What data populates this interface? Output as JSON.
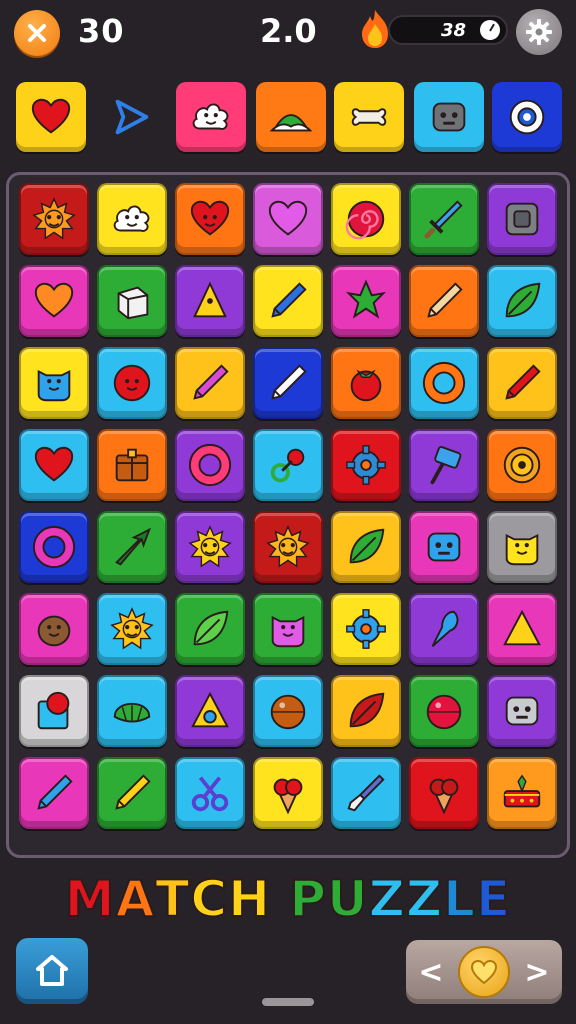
{
  "hud": {
    "moves": "30",
    "score": "2.0",
    "timer": "38",
    "close_icon": "close-icon",
    "flame_icon": "flame-icon",
    "clock_icon": "clock-icon",
    "settings_icon": "gear-icon"
  },
  "targets": [
    {
      "name": "target-heart",
      "icon": "heart",
      "bg": "#ffd21a",
      "fg": "#e0141c"
    },
    {
      "name": "target-play-arrow",
      "icon": "arrow-play",
      "bg": "none",
      "fg": "#2c80e8"
    },
    {
      "name": "target-cloud-face",
      "icon": "cloud-face",
      "bg": "#ff3b78",
      "fg": "#ffffff"
    },
    {
      "name": "target-hill",
      "icon": "hill",
      "bg": "#ff7a14",
      "fg": "#ffffff"
    },
    {
      "name": "target-bone",
      "icon": "bone",
      "bg": "#ffd21a",
      "fg": "#f1eee5"
    },
    {
      "name": "target-robot",
      "icon": "robot",
      "bg": "#2fbef0",
      "fg": "#6f7377"
    },
    {
      "name": "target-eye-ring",
      "icon": "eye-ring",
      "bg": "#1e3ad6",
      "fg": "#ffffff"
    }
  ],
  "board": {
    "tiles": [
      [
        {
          "icon": "sun-face",
          "bg": "#c41a1a",
          "fg": "#ff9a1e"
        },
        {
          "icon": "cloud-face",
          "bg": "#ffe31e",
          "fg": "#ffffff"
        },
        {
          "icon": "heart-face",
          "bg": "#ff7514",
          "fg": "#e0141c"
        },
        {
          "icon": "heart",
          "bg": "#d95bdc",
          "fg": "#e25be8"
        },
        {
          "icon": "swirl",
          "bg": "#ffe31e",
          "fg": "#e0143c"
        },
        {
          "icon": "sword",
          "bg": "#2dad36",
          "fg": "#3da2ec"
        },
        {
          "icon": "block",
          "bg": "#8f3ad6",
          "fg": "#7c7f86"
        }
      ],
      [
        {
          "icon": "heart",
          "bg": "#e837b8",
          "fg": "#ff8a24"
        },
        {
          "icon": "cube",
          "bg": "#2dad36",
          "fg": "#f2f2f2"
        },
        {
          "icon": "cone",
          "bg": "#8f3ad6",
          "fg": "#ffd21a"
        },
        {
          "icon": "pencil",
          "bg": "#ffe31e",
          "fg": "#2c6fe0"
        },
        {
          "icon": "leaf-star",
          "bg": "#e837b8",
          "fg": "#2dad36"
        },
        {
          "icon": "pencil",
          "bg": "#ff7514",
          "fg": "#f4d8a0"
        },
        {
          "icon": "leaf",
          "bg": "#2fbef0",
          "fg": "#2dad36"
        }
      ],
      [
        {
          "icon": "cat-face",
          "bg": "#ffe31e",
          "fg": "#2fa2ec"
        },
        {
          "icon": "ball-face",
          "bg": "#2fbef0",
          "fg": "#e0141c"
        },
        {
          "icon": "pencil",
          "bg": "#ffc21a",
          "fg": "#d94bd1"
        },
        {
          "icon": "pencil",
          "bg": "#1e3ad6",
          "fg": "#ffffff"
        },
        {
          "icon": "tomato",
          "bg": "#ff7514",
          "fg": "#e0141c"
        },
        {
          "icon": "ring",
          "bg": "#2fbef0",
          "fg": "#ff7514"
        },
        {
          "icon": "pencil",
          "bg": "#ffc21a",
          "fg": "#e0141c"
        }
      ],
      [
        {
          "icon": "heart",
          "bg": "#2fbef0",
          "fg": "#e0141c"
        },
        {
          "icon": "chest",
          "bg": "#ff7514",
          "fg": "#c45c12"
        },
        {
          "icon": "ring",
          "bg": "#8f3ad6",
          "fg": "#ff3b78"
        },
        {
          "icon": "pin",
          "bg": "#2fbef0",
          "fg": "#2dad36"
        },
        {
          "icon": "gear",
          "bg": "#e0141c",
          "fg": "#2f8ad6"
        },
        {
          "icon": "hammer",
          "bg": "#8f3ad6",
          "fg": "#3da2ec"
        },
        {
          "icon": "coin",
          "bg": "#ff7514",
          "fg": "#f0a31e"
        }
      ],
      [
        {
          "icon": "ring",
          "bg": "#1e3ad6",
          "fg": "#e837b8"
        },
        {
          "icon": "arrow",
          "bg": "#2dad36",
          "fg": "#1d7a2a"
        },
        {
          "icon": "sun-face",
          "bg": "#8f3ad6",
          "fg": "#ffd21a"
        },
        {
          "icon": "sun-face",
          "bg": "#c41a1a",
          "fg": "#ffb51e"
        },
        {
          "icon": "leaf",
          "bg": "#ffc21a",
          "fg": "#2dad36"
        },
        {
          "icon": "robot",
          "bg": "#e837b8",
          "fg": "#2fa2ec"
        },
        {
          "icon": "cat-face",
          "bg": "#9c9a9e",
          "fg": "#ffe31e"
        }
      ],
      [
        {
          "icon": "potato-face",
          "bg": "#e837b8",
          "fg": "#8b5a32"
        },
        {
          "icon": "sun-face",
          "bg": "#2fbef0",
          "fg": "#ffc21a"
        },
        {
          "icon": "leaf",
          "bg": "#2dad36",
          "fg": "#5ed14a"
        },
        {
          "icon": "cat-face",
          "bg": "#2dad36",
          "fg": "#e25be8"
        },
        {
          "icon": "gear",
          "bg": "#ffe31e",
          "fg": "#2fa2ec"
        },
        {
          "icon": "drop",
          "bg": "#8f3ad6",
          "fg": "#2fa2ec"
        },
        {
          "icon": "triangle",
          "bg": "#e837b8",
          "fg": "#ffd21a"
        }
      ],
      [
        {
          "icon": "balloon-card",
          "bg": "#d8d6d8",
          "fg": "#e0141c"
        },
        {
          "icon": "shell",
          "bg": "#2fbef0",
          "fg": "#2dad36"
        },
        {
          "icon": "triangle-eye",
          "bg": "#8f3ad6",
          "fg": "#2fa2ec"
        },
        {
          "icon": "ball",
          "bg": "#2fbef0",
          "fg": "#c45c12"
        },
        {
          "icon": "leaf",
          "bg": "#ffc21a",
          "fg": "#c41a1a"
        },
        {
          "icon": "ball",
          "bg": "#2dad36",
          "fg": "#e0143c"
        },
        {
          "icon": "robot",
          "bg": "#8f3ad6",
          "fg": "#c8cbd0"
        }
      ],
      [
        {
          "icon": "pencil",
          "bg": "#e837b8",
          "fg": "#2fa2ec"
        },
        {
          "icon": "pencil",
          "bg": "#2dad36",
          "fg": "#ffd21a"
        },
        {
          "icon": "scissors",
          "bg": "#2fbef0",
          "fg": "#5a3fd0"
        },
        {
          "icon": "ice-cream",
          "bg": "#ffe31e",
          "fg": "#e0141c"
        },
        {
          "icon": "brush",
          "bg": "#2fbef0",
          "fg": "#5a6fd0"
        },
        {
          "icon": "ice-cream",
          "bg": "#e0141c",
          "fg": "#c41a1a"
        },
        {
          "icon": "cake",
          "bg": "#ff9a1e",
          "fg": "#e0141c"
        }
      ]
    ]
  },
  "title": {
    "letters": [
      "M",
      "A",
      "T",
      "C",
      "H",
      " ",
      "P",
      "U",
      "Z",
      "Z",
      "L",
      "E"
    ],
    "colors": [
      "#e0141c",
      "#ff7514",
      "#ffc21a",
      "#ffd21a",
      "#ffd21a",
      " ",
      "#2dad36",
      "#2dad36",
      "#2fbef0",
      "#2fbef0",
      "#1e8ad6",
      "#1e5ad6"
    ]
  },
  "bottom": {
    "home_icon": "home-icon",
    "left_label": "<",
    "right_label": ">",
    "heart_icon": "heart-icon"
  }
}
